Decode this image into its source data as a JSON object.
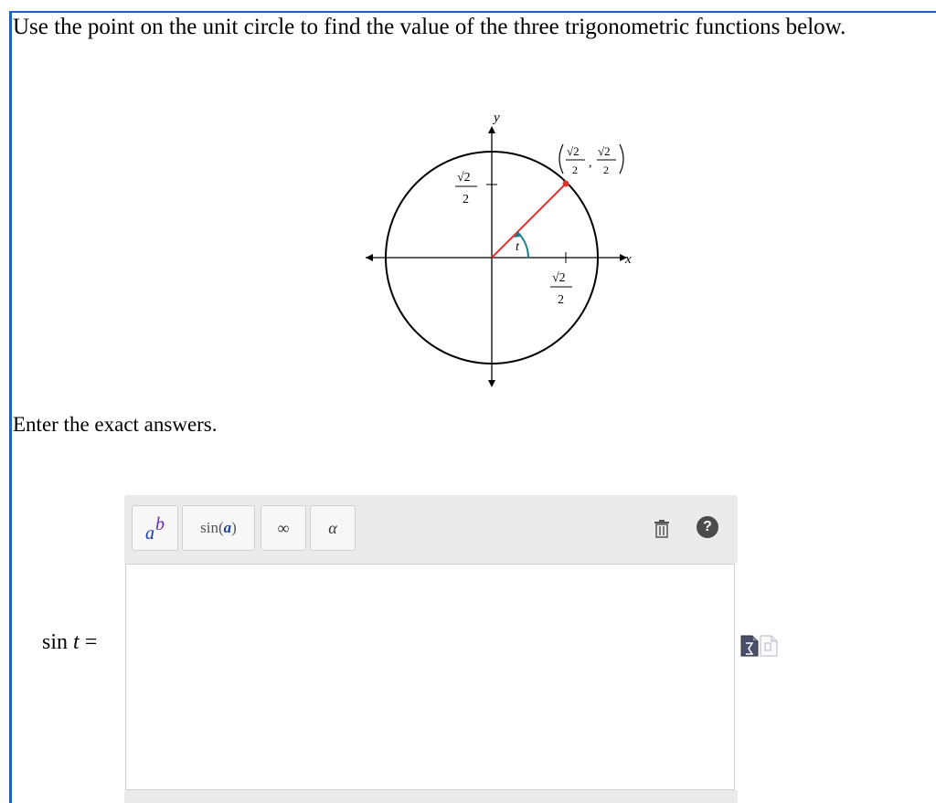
{
  "question": {
    "prompt": "Use the point on the unit circle to find the value of the three trigonometric functions below.",
    "instruction": "Enter the exact answers."
  },
  "figure": {
    "y_axis_label": "y",
    "x_axis_label": "x",
    "angle_label": "t",
    "point_label": "(√2/2, √2/2)",
    "y_tick_label": "√2/2",
    "x_tick_label": "√2/2",
    "sqrt2": "√2",
    "denominator": "2",
    "comma": ",",
    "radius_color": "#e03131",
    "angle_arc_color": "#1b7a8a"
  },
  "toolbar": {
    "power": {
      "base": "a",
      "exponent": "b"
    },
    "sin": {
      "func": "sin",
      "open": " (",
      "arg": "a",
      "close": ")"
    },
    "infinity": "∞",
    "alpha": "α",
    "trash_icon": "trash-icon",
    "help": "?"
  },
  "answer": {
    "func": "sin",
    "var": "t",
    "equals": "="
  },
  "side_icons": [
    "sigma-doc-icon",
    "page-icon"
  ]
}
